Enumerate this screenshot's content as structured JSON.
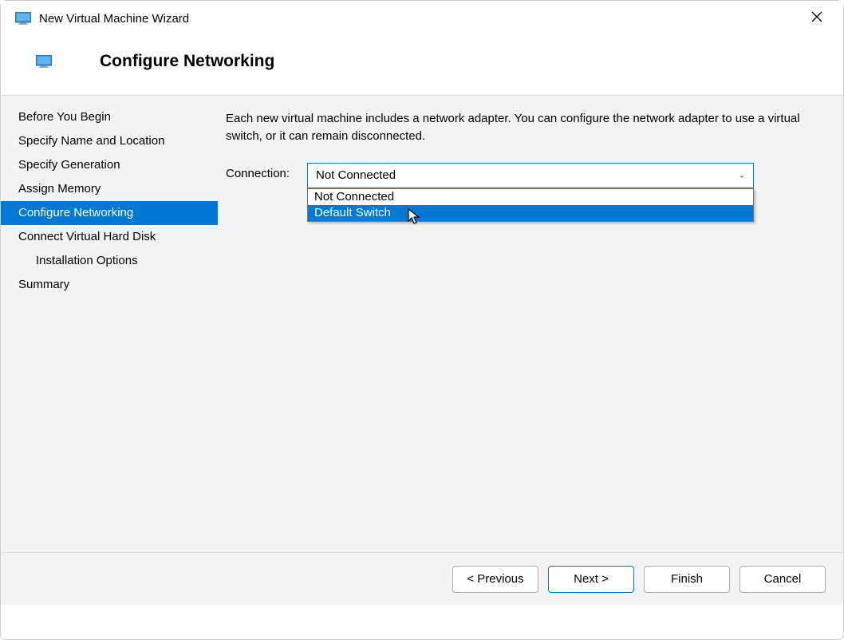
{
  "window": {
    "title": "New Virtual Machine Wizard"
  },
  "header": {
    "title": "Configure Networking"
  },
  "sidebar": {
    "steps": [
      {
        "label": "Before You Begin",
        "active": false,
        "indent": false
      },
      {
        "label": "Specify Name and Location",
        "active": false,
        "indent": false
      },
      {
        "label": "Specify Generation",
        "active": false,
        "indent": false
      },
      {
        "label": "Assign Memory",
        "active": false,
        "indent": false
      },
      {
        "label": "Configure Networking",
        "active": true,
        "indent": false
      },
      {
        "label": "Connect Virtual Hard Disk",
        "active": false,
        "indent": false
      },
      {
        "label": "Installation Options",
        "active": false,
        "indent": true
      },
      {
        "label": "Summary",
        "active": false,
        "indent": false
      }
    ]
  },
  "content": {
    "description": "Each new virtual machine includes a network adapter. You can configure the network adapter to use a virtual switch, or it can remain disconnected.",
    "connection_label": "Connection:",
    "connection_value": "Not Connected",
    "dropdown_options": [
      {
        "label": "Not Connected",
        "selected": false
      },
      {
        "label": "Default Switch",
        "selected": true
      }
    ]
  },
  "footer": {
    "previous": "< Previous",
    "next": "Next >",
    "finish": "Finish",
    "cancel": "Cancel"
  }
}
